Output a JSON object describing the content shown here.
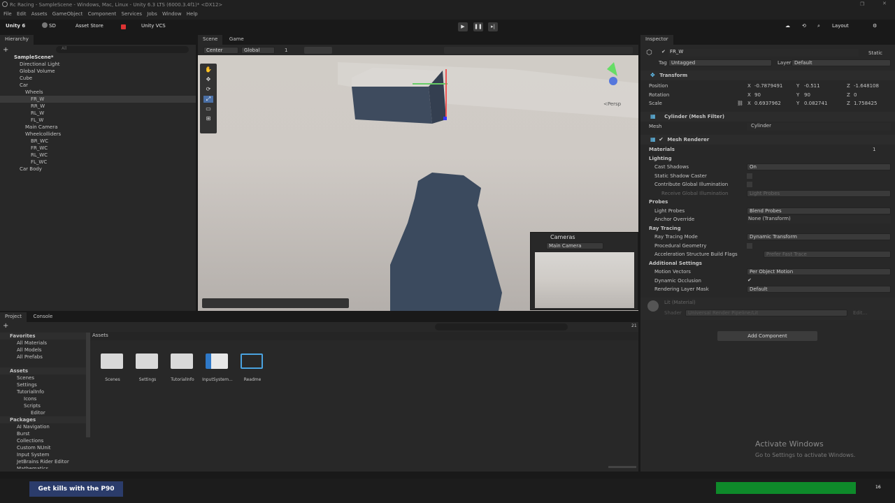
{
  "window": {
    "title": "Rc Racing - SampleScene - Windows, Mac, Linux - Unity 6.3 LTS (6000.3.4f1)* <DX12>"
  },
  "menu": [
    "File",
    "Edit",
    "Assets",
    "GameObject",
    "Component",
    "Services",
    "Jobs",
    "Window",
    "Help"
  ],
  "toolbar": {
    "account": "Unity 6",
    "user": "SD",
    "asset_store": "Asset Store",
    "vcs": "Unity VCS",
    "layout": "Layout"
  },
  "hierarchy": {
    "tab": "Hierarchy",
    "search_placeholder": "All",
    "items": [
      {
        "label": "SampleScene*",
        "depth": 0
      },
      {
        "label": "Directional Light",
        "depth": 1
      },
      {
        "label": "Global Volume",
        "depth": 1
      },
      {
        "label": "Cube",
        "depth": 1
      },
      {
        "label": "Car",
        "depth": 1
      },
      {
        "label": "Wheels",
        "depth": 2
      },
      {
        "label": "FR_W",
        "depth": 3
      },
      {
        "label": "RR_W",
        "depth": 3
      },
      {
        "label": "RL_W",
        "depth": 3
      },
      {
        "label": "FL_W",
        "depth": 3
      },
      {
        "label": "Main Camera",
        "depth": 2
      },
      {
        "label": "Wheelcolliders",
        "depth": 2
      },
      {
        "label": "BR_WC",
        "depth": 3
      },
      {
        "label": "FR_WC",
        "depth": 3
      },
      {
        "label": "RL_WC",
        "depth": 3
      },
      {
        "label": "FL_WC",
        "depth": 3
      },
      {
        "label": "Car Body",
        "depth": 1
      }
    ]
  },
  "scene": {
    "tab_scene": "Scene",
    "tab_game": "Game",
    "pivot": "Center",
    "space": "Global",
    "grid": "1",
    "persp": "<Persp",
    "cameras_title": "Cameras",
    "camera_select": "Main Camera"
  },
  "inspector": {
    "tab": "Inspector",
    "object_name": "FR_W",
    "static": "Static",
    "tag_label": "Tag",
    "tag": "Untagged",
    "layer_label": "Layer",
    "layer": "Default",
    "transform": {
      "title": "Transform",
      "position_label": "Position",
      "rotation_label": "Rotation",
      "scale_label": "Scale",
      "position": {
        "x": "-0.7879491",
        "y": "-0.511",
        "z": "-1.648108"
      },
      "rotation": {
        "x": "90",
        "y": "90",
        "z": "0"
      },
      "scale": {
        "x": "0.6937962",
        "y": "0.082741",
        "z": "1.758425"
      }
    },
    "mesh_filter": {
      "title": "Cylinder (Mesh Filter)",
      "mesh_label": "Mesh",
      "mesh": "Cylinder"
    },
    "mesh_renderer": {
      "title": "Mesh Renderer",
      "materials_label": "Materials",
      "materials_count": "1",
      "lighting": "Lighting",
      "cast_shadows_label": "Cast Shadows",
      "cast_shadows": "On",
      "static_shadow_caster": "Static Shadow Caster",
      "contribute_gi": "Contribute Global Illumination",
      "receive_gi_label": "Receive Global Illumination",
      "receive_gi": "Light Probes",
      "probes": "Probes",
      "light_probes_label": "Light Probes",
      "light_probes": "Blend Probes",
      "anchor_label": "Anchor Override",
      "anchor": "None (Transform)",
      "ray_tracing": "Ray Tracing",
      "rt_mode_label": "Ray Tracing Mode",
      "rt_mode": "Dynamic Transform",
      "procedural": "Procedural Geometry",
      "accel_label": "Acceleration Structure Build Flags",
      "accel": "Prefer Fast Trace",
      "additional": "Additional Settings",
      "motion_label": "Motion Vectors",
      "motion": "Per Object Motion",
      "occlusion_label": "Dynamic Occlusion",
      "rlm_label": "Rendering Layer Mask",
      "rlm": "Default"
    },
    "material": {
      "title": "Lit (Material)",
      "shader_label": "Shader",
      "shader": "Universal Render Pipeline/Lit",
      "edit": "Edit..."
    },
    "add_component": "Add Component"
  },
  "project": {
    "tab_project": "Project",
    "tab_console": "Console",
    "breadcrumb": "Assets",
    "count": "21",
    "tree": [
      {
        "label": "Favorites",
        "depth": 0,
        "bold": true
      },
      {
        "label": "All Materials",
        "depth": 1
      },
      {
        "label": "All Models",
        "depth": 1
      },
      {
        "label": "All Prefabs",
        "depth": 1
      },
      {
        "label": "",
        "depth": 0
      },
      {
        "label": "Assets",
        "depth": 0,
        "bold": true
      },
      {
        "label": "Scenes",
        "depth": 1
      },
      {
        "label": "Settings",
        "depth": 1
      },
      {
        "label": "TutorialInfo",
        "depth": 1
      },
      {
        "label": "Icons",
        "depth": 2
      },
      {
        "label": "Scripts",
        "depth": 2
      },
      {
        "label": "Editor",
        "depth": 3
      },
      {
        "label": "Packages",
        "depth": 0,
        "bold": true
      },
      {
        "label": "AI Navigation",
        "depth": 1
      },
      {
        "label": "Burst",
        "depth": 1
      },
      {
        "label": "Collections",
        "depth": 1
      },
      {
        "label": "Custom NUnit",
        "depth": 1
      },
      {
        "label": "Input System",
        "depth": 1
      },
      {
        "label": "JetBrains Rider Editor",
        "depth": 1
      },
      {
        "label": "Mathematics",
        "depth": 1
      }
    ],
    "assets": [
      "Scenes",
      "Settings",
      "TutorialInfo",
      "InputSystem...",
      "Readme"
    ]
  },
  "watermark": {
    "line1": "Activate Windows",
    "line2": "Go to Settings to activate Windows."
  },
  "taskbar": {
    "ad": "Get kills with the P90",
    "notif": "16"
  }
}
